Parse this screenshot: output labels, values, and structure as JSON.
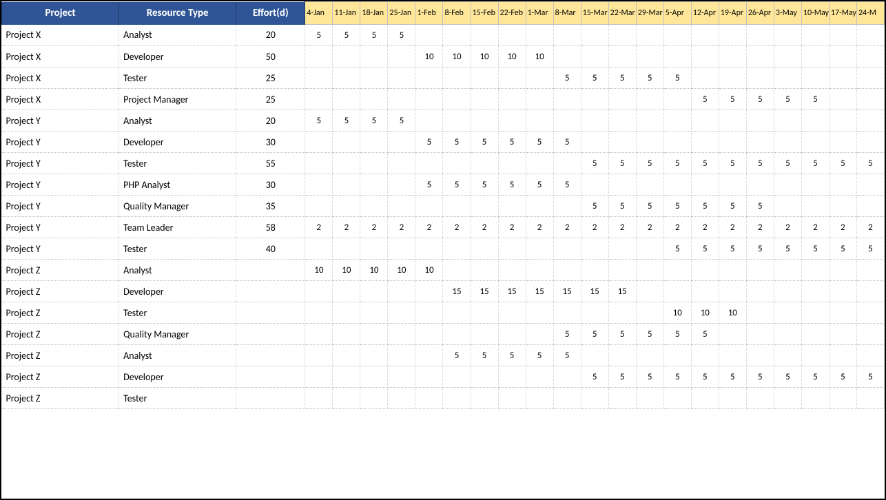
{
  "headers": {
    "project": "Project",
    "resource": "Resource Type",
    "effort": "Effort(d)"
  },
  "dates": [
    "4-Jan",
    "11-Jan",
    "18-Jan",
    "25-Jan",
    "1-Feb",
    "8-Feb",
    "15-Feb",
    "22-Feb",
    "1-Mar",
    "8-Mar",
    "15-Mar",
    "22-Mar",
    "29-Mar",
    "5-Apr",
    "12-Apr",
    "19-Apr",
    "26-Apr",
    "3-May",
    "10-May",
    "17-May",
    "24-M"
  ],
  "rows": [
    {
      "project": "Project X",
      "resource": "Analyst",
      "effort": "20",
      "vals": [
        "5",
        "5",
        "5",
        "5",
        "",
        "",
        "",
        "",
        "",
        "",
        "",
        "",
        "",
        "",
        "",
        "",
        "",
        "",
        "",
        "",
        ""
      ]
    },
    {
      "project": "Project X",
      "resource": "Developer",
      "effort": "50",
      "vals": [
        "",
        "",
        "",
        "",
        "10",
        "10",
        "10",
        "10",
        "10",
        "",
        "",
        "",
        "",
        "",
        "",
        "",
        "",
        "",
        "",
        "",
        ""
      ]
    },
    {
      "project": "Project X",
      "resource": "Tester",
      "effort": "25",
      "vals": [
        "",
        "",
        "",
        "",
        "",
        "",
        "",
        "",
        "",
        "5",
        "5",
        "5",
        "5",
        "5",
        "",
        "",
        "",
        "",
        "",
        "",
        ""
      ]
    },
    {
      "project": "Project X",
      "resource": "Project Manager",
      "effort": "25",
      "vals": [
        "",
        "",
        "",
        "",
        "",
        "",
        "",
        "",
        "",
        "",
        "",
        "",
        "",
        "",
        "5",
        "5",
        "5",
        "5",
        "5",
        "",
        ""
      ]
    },
    {
      "project": "Project Y",
      "resource": "Analyst",
      "effort": "20",
      "vals": [
        "5",
        "5",
        "5",
        "5",
        "",
        "",
        "",
        "",
        "",
        "",
        "",
        "",
        "",
        "",
        "",
        "",
        "",
        "",
        "",
        "",
        ""
      ]
    },
    {
      "project": "Project Y",
      "resource": "Developer",
      "effort": "30",
      "vals": [
        "",
        "",
        "",
        "",
        "5",
        "5",
        "5",
        "5",
        "5",
        "5",
        "",
        "",
        "",
        "",
        "",
        "",
        "",
        "",
        "",
        "",
        ""
      ]
    },
    {
      "project": "Project Y",
      "resource": "Tester",
      "effort": "55",
      "vals": [
        "",
        "",
        "",
        "",
        "",
        "",
        "",
        "",
        "",
        "",
        "5",
        "5",
        "5",
        "5",
        "5",
        "5",
        "5",
        "5",
        "5",
        "5",
        "5"
      ]
    },
    {
      "project": "Project Y",
      "resource": "PHP Analyst",
      "effort": "30",
      "vals": [
        "",
        "",
        "",
        "",
        "5",
        "5",
        "5",
        "5",
        "5",
        "5",
        "",
        "",
        "",
        "",
        "",
        "",
        "",
        "",
        "",
        "",
        ""
      ]
    },
    {
      "project": "Project Y",
      "resource": "Quality Manager",
      "effort": "35",
      "vals": [
        "",
        "",
        "",
        "",
        "",
        "",
        "",
        "",
        "",
        "",
        "5",
        "5",
        "5",
        "5",
        "5",
        "5",
        "5",
        "",
        "",
        "",
        ""
      ]
    },
    {
      "project": "Project Y",
      "resource": "Team Leader",
      "effort": "58",
      "vals": [
        "2",
        "2",
        "2",
        "2",
        "2",
        "2",
        "2",
        "2",
        "2",
        "2",
        "2",
        "2",
        "2",
        "2",
        "2",
        "2",
        "2",
        "2",
        "2",
        "2",
        "2"
      ]
    },
    {
      "project": "Project Y",
      "resource": "Tester",
      "effort": "40",
      "vals": [
        "",
        "",
        "",
        "",
        "",
        "",
        "",
        "",
        "",
        "",
        "",
        "",
        "",
        "5",
        "5",
        "5",
        "5",
        "5",
        "5",
        "5",
        "5"
      ]
    },
    {
      "project": "Project Z",
      "resource": "Analyst",
      "effort": "",
      "vals": [
        "10",
        "10",
        "10",
        "10",
        "10",
        "",
        "",
        "",
        "",
        "",
        "",
        "",
        "",
        "",
        "",
        "",
        "",
        "",
        "",
        "",
        ""
      ]
    },
    {
      "project": "Project Z",
      "resource": "Developer",
      "effort": "",
      "vals": [
        "",
        "",
        "",
        "",
        "",
        "15",
        "15",
        "15",
        "15",
        "15",
        "15",
        "15",
        "",
        "",
        "",
        "",
        "",
        "",
        "",
        "",
        ""
      ]
    },
    {
      "project": "Project Z",
      "resource": "Tester",
      "effort": "",
      "vals": [
        "",
        "",
        "",
        "",
        "",
        "",
        "",
        "",
        "",
        "",
        "",
        "",
        "",
        "10",
        "10",
        "10",
        "",
        "",
        "",
        "",
        ""
      ]
    },
    {
      "project": "Project Z",
      "resource": "Quality Manager",
      "effort": "",
      "vals": [
        "",
        "",
        "",
        "",
        "",
        "",
        "",
        "",
        "",
        "5",
        "5",
        "5",
        "5",
        "5",
        "5",
        "",
        "",
        "",
        "",
        "",
        ""
      ]
    },
    {
      "project": "Project Z",
      "resource": "Analyst",
      "effort": "",
      "vals": [
        "",
        "",
        "",
        "",
        "",
        "5",
        "5",
        "5",
        "5",
        "5",
        "",
        "",
        "",
        "",
        "",
        "",
        "",
        "",
        "",
        "",
        ""
      ]
    },
    {
      "project": "Project Z",
      "resource": "Developer",
      "effort": "",
      "vals": [
        "",
        "",
        "",
        "",
        "",
        "",
        "",
        "",
        "",
        "",
        "5",
        "5",
        "5",
        "5",
        "5",
        "5",
        "5",
        "5",
        "5",
        "5",
        "5"
      ]
    },
    {
      "project": "Project Z",
      "resource": "Tester",
      "effort": "",
      "vals": [
        "",
        "",
        "",
        "",
        "",
        "",
        "",
        "",
        "",
        "",
        "",
        "",
        "",
        "",
        "",
        "",
        "",
        "",
        "",
        "",
        ""
      ]
    }
  ]
}
